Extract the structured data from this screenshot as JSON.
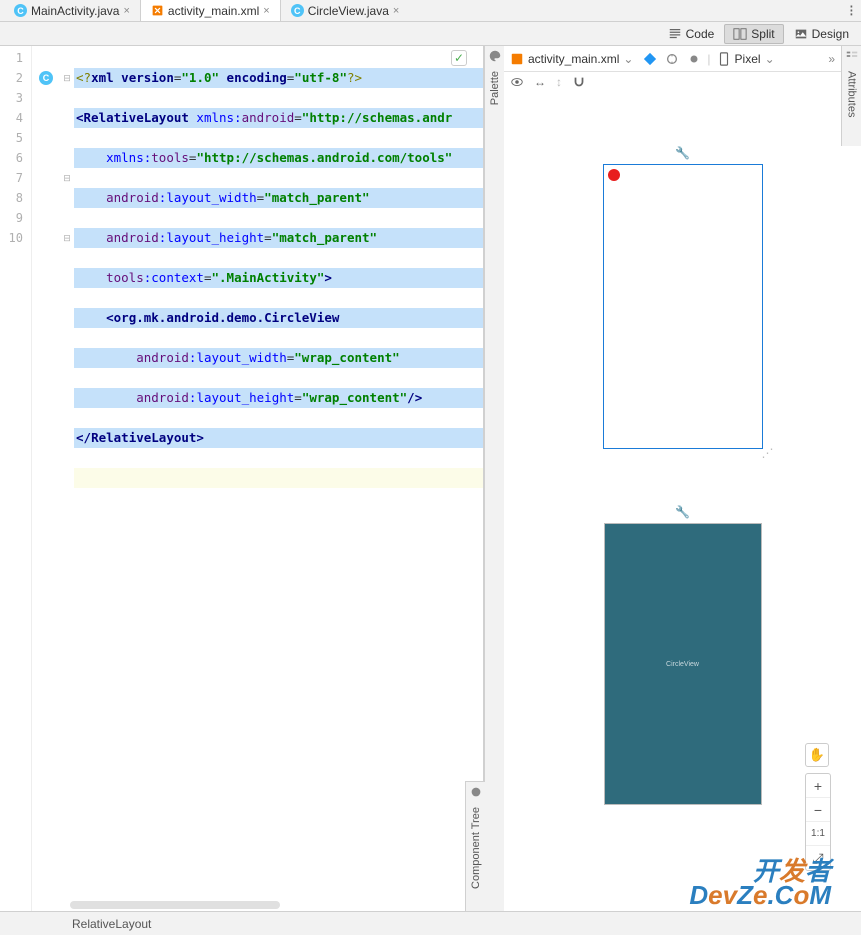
{
  "tabs": [
    {
      "label": "MainActivity.java",
      "icon": "C",
      "icon_color": "#4fc3f7"
    },
    {
      "label": "activity_main.xml",
      "icon": "⟠",
      "icon_color": "#f57c00"
    },
    {
      "label": "CircleView.java",
      "icon": "C",
      "icon_color": "#4fc3f7"
    }
  ],
  "view_modes": {
    "code": "Code",
    "split": "Split",
    "design": "Design"
  },
  "code": {
    "line_count": 10,
    "lines": {
      "l1a": "<?",
      "l1b": "xml version",
      "l1c": "=",
      "l1d": "\"1.0\"",
      "l1e": " encoding",
      "l1f": "=",
      "l1g": "\"utf-8\"",
      "l1h": "?>",
      "l2a": "<",
      "l2b": "RelativeLayout ",
      "l2c": "xmlns:",
      "l2d": "android",
      "l2e": "=",
      "l2f": "\"http://schemas.andr",
      "l3a": "    ",
      "l3b": "xmlns:",
      "l3c": "tools",
      "l3d": "=",
      "l3e": "\"http://schemas.android.com/tools\"",
      "l4a": "    ",
      "l4b": "android",
      "l4c": ":",
      "l4d": "layout_width",
      "l4e": "=",
      "l4f": "\"match_parent\"",
      "l5a": "    ",
      "l5b": "android",
      "l5c": ":",
      "l5d": "layout_height",
      "l5e": "=",
      "l5f": "\"match_parent\"",
      "l6a": "    ",
      "l6b": "tools",
      "l6c": ":",
      "l6d": "context",
      "l6e": "=",
      "l6f": "\".MainActivity\"",
      "l6g": ">",
      "l7a": "    <",
      "l7b": "org.mk.android.demo.CircleView",
      "l8a": "        ",
      "l8b": "android",
      "l8c": ":",
      "l8d": "layout_width",
      "l8e": "=",
      "l8f": "\"wrap_content\"",
      "l9a": "        ",
      "l9b": "android",
      "l9c": ":",
      "l9d": "layout_height",
      "l9e": "=",
      "l9f": "\"wrap_content\"",
      "l9g": "/>",
      "l10a": "</",
      "l10b": "RelativeLayout",
      "l10c": ">"
    }
  },
  "side_rails": {
    "palette": "Palette",
    "component_tree": "Component Tree",
    "attributes": "Attributes"
  },
  "preview": {
    "file_label": "activity_main.xml",
    "device_label": "Pixel",
    "blueprint_label": "CircleView"
  },
  "zoom": {
    "plus": "+",
    "minus": "−",
    "one_to_one": "1:1",
    "fit": "⤢"
  },
  "status": {
    "breadcrumb": "RelativeLayout"
  },
  "watermark": {
    "line1a": "开",
    "line1b": "发",
    "line1c": "者",
    "line2a": "D",
    "line2b": "ev",
    "line2c": "Z",
    "line2d": "e",
    "line2e": ".C",
    "line2f": "o",
    "line2g": "M"
  }
}
